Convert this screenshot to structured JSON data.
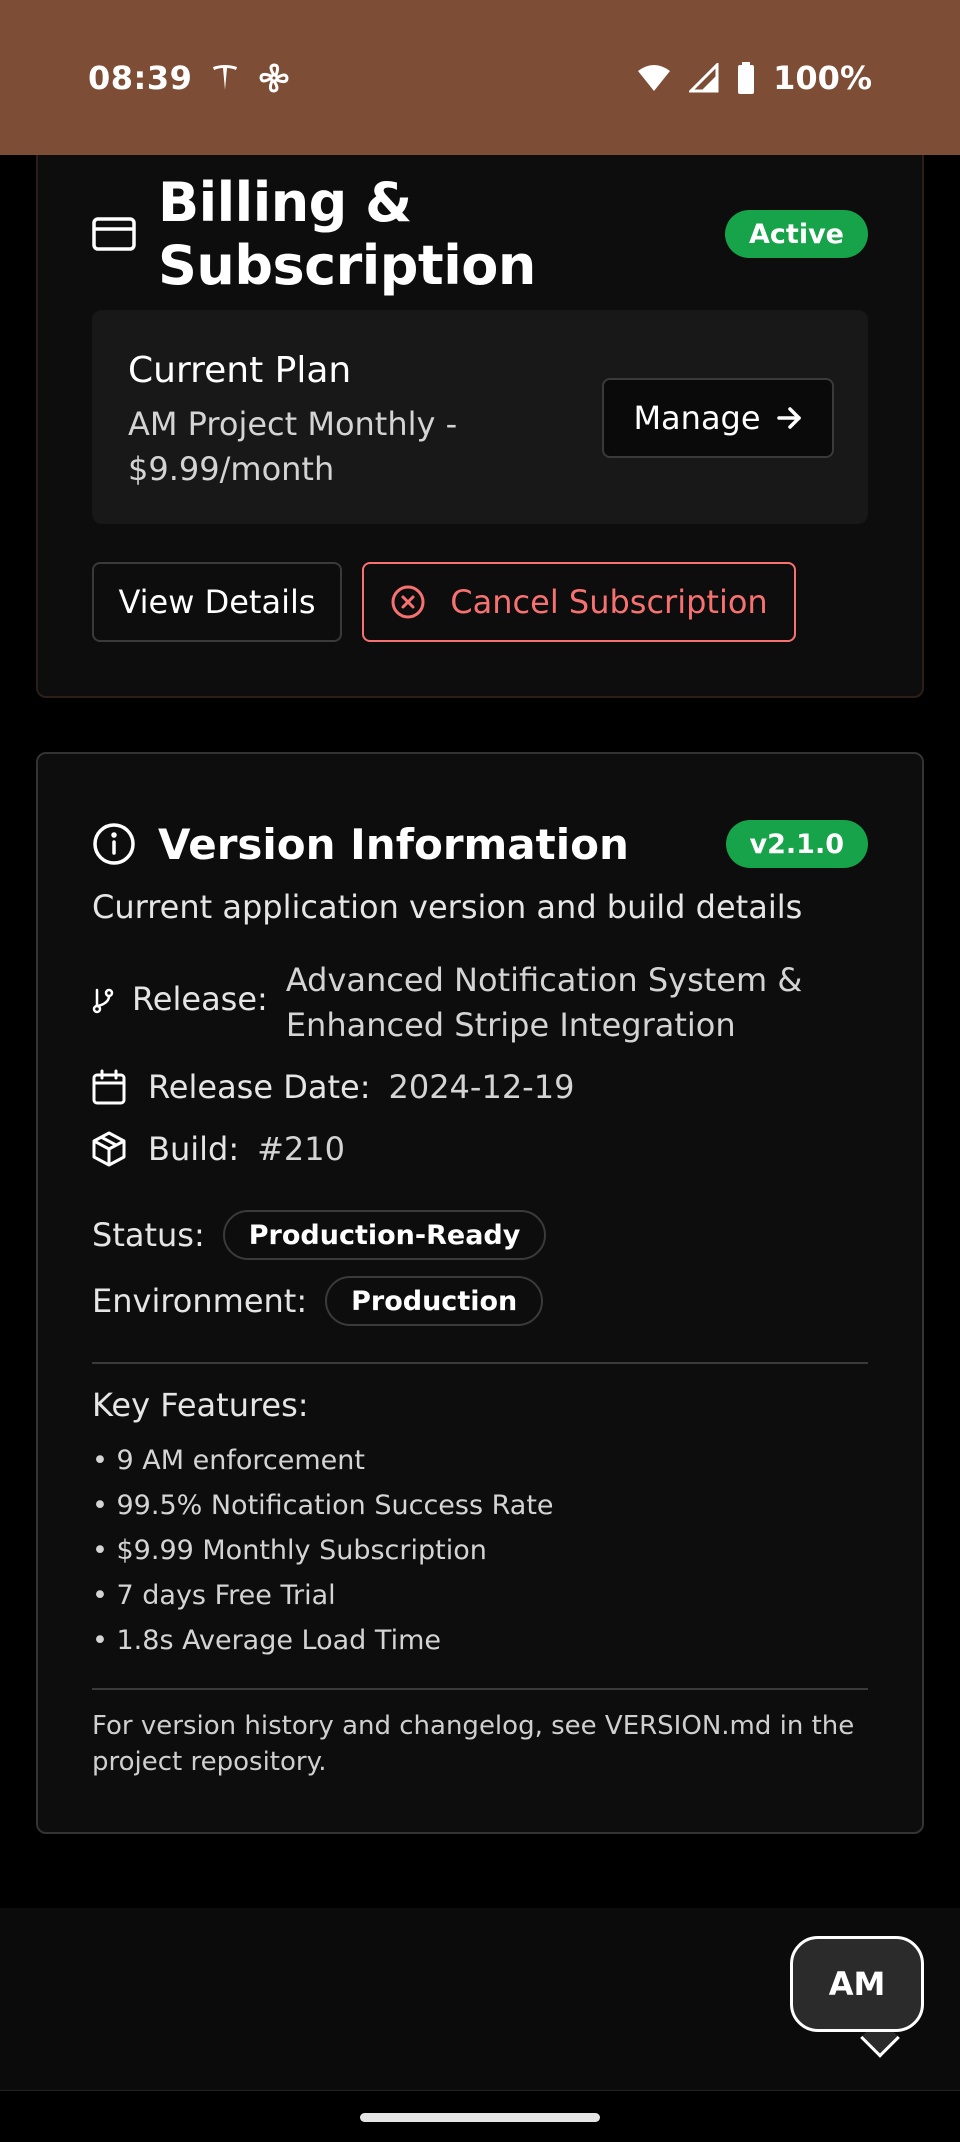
{
  "status_bar": {
    "time": "08:39",
    "battery": "100%",
    "icons": [
      "tesla-icon",
      "fan-icon",
      "wifi-icon",
      "signal-icon",
      "battery-icon"
    ]
  },
  "billing": {
    "title": "Billing & Subscription",
    "status_badge": "Active",
    "plan_title": "Current Plan",
    "plan_description": "AM Project Monthly - $9.99/month",
    "manage_label": "Manage",
    "view_details_label": "View Details",
    "cancel_label": "Cancel Subscription"
  },
  "version": {
    "title": "Version Information",
    "badge": "v2.1.0",
    "subtitle": "Current application version and build details",
    "release_label": "Release:",
    "release_value": "Advanced Notification System & Enhanced Stripe Integration",
    "release_date_label": "Release Date:",
    "release_date_value": "2024-12-19",
    "build_label": "Build:",
    "build_value": "#210",
    "status_label": "Status:",
    "status_value": "Production-Ready",
    "environment_label": "Environment:",
    "environment_value": "Production",
    "features_title": "Key Features:",
    "features": [
      "• 9 AM enforcement",
      "• 99.5% Notification Success Rate",
      "• $9.99 Monthly Subscription",
      "• 7 days Free Trial",
      "• 1.8s Average Load Time"
    ],
    "footnote": "For version history and changelog, see VERSION.md in the project repository."
  },
  "fab": {
    "label": "AM"
  },
  "colors": {
    "status_bar": "#7d4d35",
    "accent_green": "#16a34a",
    "danger": "#f87171",
    "card_bg": "#0d0d0d"
  }
}
